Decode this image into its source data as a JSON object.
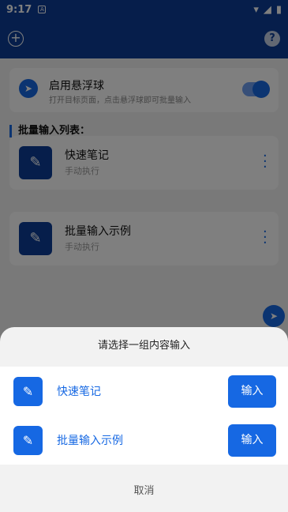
{
  "status_bar": {
    "time": "9:17",
    "notif_label": "A"
  },
  "float_toggle": {
    "title": "启用悬浮球",
    "subtitle": "打开目标页面，点击悬浮球即可批量输入",
    "enabled": true
  },
  "list_header": "批量输入列表：",
  "items": [
    {
      "name": "快速笔记",
      "mode": "手动执行"
    },
    {
      "name": "批量输入示例",
      "mode": "手动执行"
    }
  ],
  "sheet": {
    "title": "请选择一组内容输入",
    "rows": [
      {
        "label": "快速笔记",
        "button": "输入"
      },
      {
        "label": "批量输入示例",
        "button": "输入"
      }
    ],
    "cancel": "取消"
  },
  "colors": {
    "primary": "#1668e3",
    "app_bar": "#0c3d96"
  },
  "icons": [
    "add-circle-icon",
    "help-icon",
    "send-icon",
    "edit-icon",
    "more-vert-icon"
  ]
}
